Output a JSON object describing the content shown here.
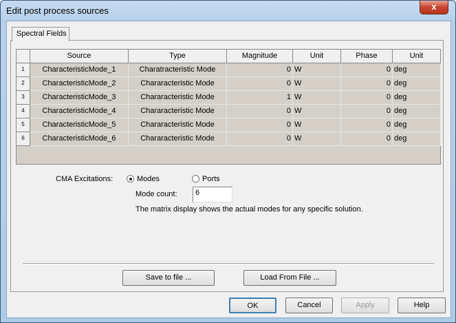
{
  "window": {
    "title": "Edit post process sources",
    "close_glyph": "x"
  },
  "tab": {
    "label": "Spectral Fields"
  },
  "grid": {
    "headers": [
      "Source",
      "Type",
      "Magnitude",
      "Unit",
      "Phase",
      "Unit"
    ],
    "rows": [
      {
        "n": "1",
        "source": "CharacteristicMode_1",
        "type": "Charatracteristic Mode",
        "magnitude": "0",
        "mag_unit": "W",
        "phase": "0",
        "phase_unit": "deg"
      },
      {
        "n": "2",
        "source": "CharacteristicMode_2",
        "type": "Chararacteristic Mode",
        "magnitude": "0",
        "mag_unit": "W",
        "phase": "0",
        "phase_unit": "deg"
      },
      {
        "n": "3",
        "source": "CharacteristicMode_3",
        "type": "Chararacteristic Mode",
        "magnitude": "1",
        "mag_unit": "W",
        "phase": "0",
        "phase_unit": "deg"
      },
      {
        "n": "4",
        "source": "CharacteristicMode_4",
        "type": "Chararacteristic Mode",
        "magnitude": "0",
        "mag_unit": "W",
        "phase": "0",
        "phase_unit": "deg"
      },
      {
        "n": "5",
        "source": "CharacteristicMode_5",
        "type": "Chararacteristic Mode",
        "magnitude": "0",
        "mag_unit": "W",
        "phase": "0",
        "phase_unit": "deg"
      },
      {
        "n": "6",
        "source": "CharacteristicMode_6",
        "type": "Chararacteristic Mode",
        "magnitude": "0",
        "mag_unit": "W",
        "phase": "0",
        "phase_unit": "deg"
      }
    ]
  },
  "cma": {
    "label": "CMA Excitations:",
    "modes": "Modes",
    "ports": "Ports",
    "selected": "Modes",
    "mode_count_label": "Mode count:",
    "mode_count": "6",
    "info": "The matrix display shows the actual modes for any specific solution."
  },
  "buttons": {
    "save": "Save to file ...",
    "load": "Load From File ...",
    "ok": "OK",
    "cancel": "Cancel",
    "apply": "Apply",
    "help": "Help"
  }
}
